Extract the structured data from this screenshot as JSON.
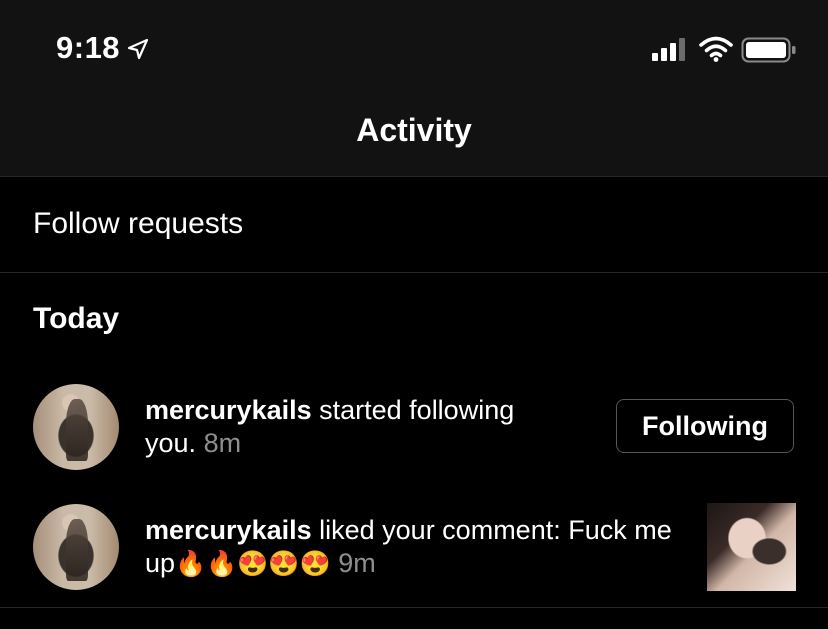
{
  "status_bar": {
    "time": "9:18",
    "icons": [
      "location-arrow-icon",
      "cellular-signal-icon",
      "wifi-icon",
      "battery-icon"
    ]
  },
  "nav": {
    "title": "Activity"
  },
  "follow_requests": {
    "label": "Follow requests"
  },
  "sections": [
    {
      "heading": "Today",
      "items": [
        {
          "username": "mercurykails",
          "action": " started following you.",
          "time": "8m",
          "button": "Following"
        },
        {
          "username": "mercurykails",
          "action": " liked your comment: Fuck me up",
          "emojis": "🔥🔥😍😍😍",
          "time": "9m"
        }
      ]
    }
  ],
  "colors": {
    "background": "#000000",
    "bar": "#121212",
    "secondary_text": "#8e8e8e",
    "divider": "#262626"
  }
}
